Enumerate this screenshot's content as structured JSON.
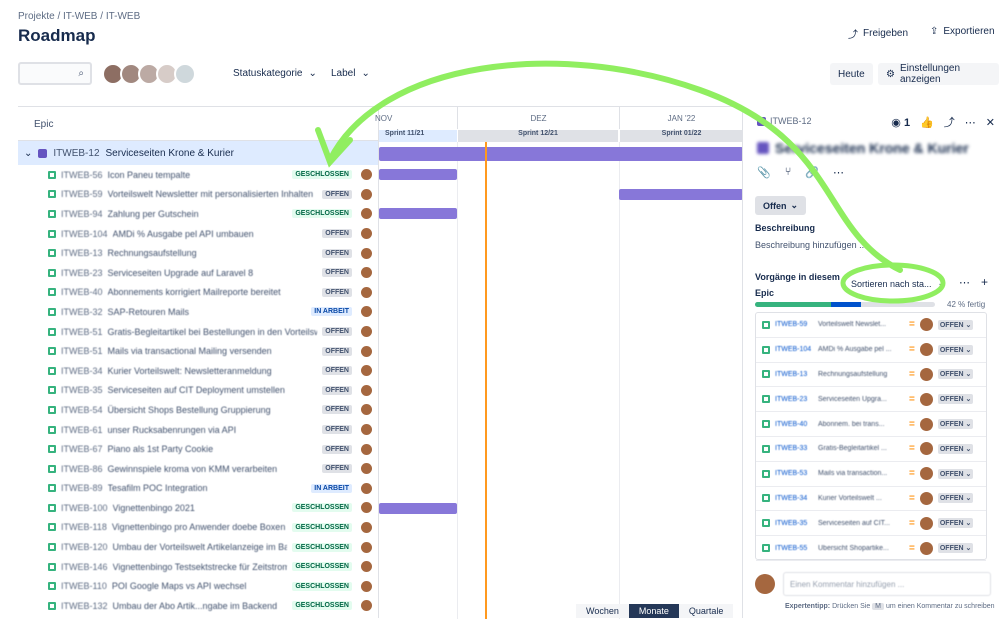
{
  "breadcrumb": [
    "Projekte",
    "/",
    "IT-WEB",
    "/",
    "IT-WEB"
  ],
  "page_title": "Roadmap",
  "header": {
    "share": "Freigeben",
    "export": "Exportieren"
  },
  "toolbar": {
    "status_filter": "Statuskategorie",
    "label_filter": "Label",
    "today": "Heute",
    "settings": "Einstellungen anzeigen"
  },
  "list": {
    "column": "Epic",
    "epic_key": "ITWEB-12",
    "epic_title": "Serviceseiten Krone & Kurier"
  },
  "rows": [
    {
      "key": "ITWEB-56",
      "title": "Icon Paneu tempalte",
      "status": "GESCHLOSSEN"
    },
    {
      "key": "ITWEB-59",
      "title": "Vorteilswelt Newsletter mit personalisierten Inhalten",
      "status": "OFFEN"
    },
    {
      "key": "ITWEB-94",
      "title": "Zahlung per Gutschein",
      "status": "GESCHLOSSEN"
    },
    {
      "key": "ITWEB-104",
      "title": "AMDi % Ausgabe pel API umbauen",
      "status": "OFFEN"
    },
    {
      "key": "ITWEB-13",
      "title": "Rechnungsaufstellung",
      "status": "OFFEN"
    },
    {
      "key": "ITWEB-23",
      "title": "Serviceseiten Upgrade auf Laravel 8",
      "status": "OFFEN"
    },
    {
      "key": "ITWEB-40",
      "title": "Abonnements korrigiert Mailreporte bereitet",
      "status": "OFFEN"
    },
    {
      "key": "ITWEB-32",
      "title": "SAP-Retouren Mails",
      "status": "IN ARBEIT"
    },
    {
      "key": "ITWEB-51",
      "title": "Gratis-Begleitartikel bei Bestellungen in den Vorteilswelten",
      "status": "OFFEN"
    },
    {
      "key": "ITWEB-51",
      "title": "Mails via transactional Mailing versenden",
      "status": "OFFEN"
    },
    {
      "key": "ITWEB-34",
      "title": "Kurier Vorteilswelt: Newsletteranmeldung",
      "status": "OFFEN"
    },
    {
      "key": "ITWEB-35",
      "title": "Serviceseiten auf CIT Deployment umstellen",
      "status": "OFFEN"
    },
    {
      "key": "ITWEB-54",
      "title": "Übersicht Shops Bestellung Gruppierung",
      "status": "OFFEN"
    },
    {
      "key": "ITWEB-61",
      "title": "unser Rucksabenrungen via API",
      "status": "OFFEN"
    },
    {
      "key": "ITWEB-67",
      "title": "Piano als 1st Party Cookie",
      "status": "OFFEN"
    },
    {
      "key": "ITWEB-86",
      "title": "Gewinnspiele kroma von KMM verarbeiten",
      "status": "OFFEN"
    },
    {
      "key": "ITWEB-89",
      "title": "Tesafilm POC Integration",
      "status": "IN ARBEIT"
    },
    {
      "key": "ITWEB-100",
      "title": "Vignettenbingo 2021",
      "status": "GESCHLOSSEN"
    },
    {
      "key": "ITWEB-118",
      "title": "Vignettenbingo pro Anwender doebe Boxen",
      "status": "GESCHLOSSEN"
    },
    {
      "key": "ITWEB-120",
      "title": "Umbau der Vorteilswelt Artikelanzeige im Backend",
      "status": "GESCHLOSSEN"
    },
    {
      "key": "ITWEB-146",
      "title": "Vignettenbingo Testsektstrecke für Zeitstrom",
      "status": "GESCHLOSSEN"
    },
    {
      "key": "ITWEB-110",
      "title": "POI Google Maps vs API wechsel",
      "status": "GESCHLOSSEN"
    },
    {
      "key": "ITWEB-132",
      "title": "Umbau der Abo Artik...ngabe im Backend",
      "status": "GESCHLOSSEN"
    }
  ],
  "timeline": {
    "months": [
      "NOV",
      "DEZ",
      "JAN '22"
    ],
    "sprints": [
      "Sprint 11/21",
      "Sprint 12/21",
      "Sprint 01/22"
    ],
    "zoom": [
      "Wochen",
      "Monate",
      "Quartale"
    ],
    "zoom_selected": "Monate"
  },
  "panel": {
    "key": "ITWEB-12",
    "watchers": "1",
    "title": "Serviceseiten Krone & Kurier",
    "status": "Offen",
    "desc_label": "Beschreibung",
    "desc_placeholder": "Beschreibung hinzufügen ...",
    "children_label": "Vorgänge in diesem",
    "children_label2": "Epic",
    "sort": "Sortieren nach sta...",
    "progress_text": "42 % fertig",
    "progress": {
      "done": 0.42,
      "in_progress": 0.17
    },
    "children": [
      {
        "key": "ITWEB-59",
        "title": "Vorteilswelt Newslet...",
        "status": "OFFEN"
      },
      {
        "key": "ITWEB-104",
        "title": "AMDi % Ausgabe pel ...",
        "status": "OFFEN"
      },
      {
        "key": "ITWEB-13",
        "title": "Rechnungsaufstellung",
        "status": "OFFEN"
      },
      {
        "key": "ITWEB-23",
        "title": "Serviceseiten Upgra...",
        "status": "OFFEN"
      },
      {
        "key": "ITWEB-40",
        "title": "Abonnem. bei trans...",
        "status": "OFFEN"
      },
      {
        "key": "ITWEB-33",
        "title": "Gratis-Begleitartikel ...",
        "status": "OFFEN"
      },
      {
        "key": "ITWEB-53",
        "title": "Mails via transaction...",
        "status": "OFFEN"
      },
      {
        "key": "ITWEB-34",
        "title": "Kurier Vorteilswelt ...",
        "status": "OFFEN"
      },
      {
        "key": "ITWEB-35",
        "title": "Serviceseiten auf CIT...",
        "status": "OFFEN"
      },
      {
        "key": "ITWEB-55",
        "title": "Übersicht Shopartike...",
        "status": "OFFEN"
      }
    ],
    "comment_placeholder": "Einen Kommentar hinzufügen ...",
    "tip_label": "Expertentipp:",
    "tip_text": "Drücken Sie",
    "tip_key": "M",
    "tip_text2": "um einen Kommentar zu schreiben"
  },
  "colors": {
    "epic": "#6554c0",
    "bar": "#8777d9",
    "today": "#ff991f",
    "done": "#36b37e",
    "inprogress": "#0052cc"
  }
}
